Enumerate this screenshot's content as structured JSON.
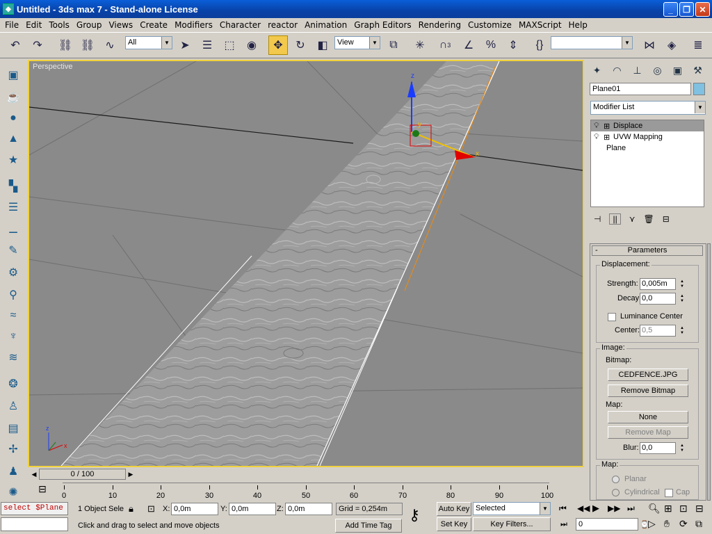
{
  "window": {
    "title": "Untitled - 3ds max 7  - Stand-alone License"
  },
  "menu": [
    "File",
    "Edit",
    "Tools",
    "Group",
    "Views",
    "Create",
    "Modifiers",
    "Character",
    "reactor",
    "Animation",
    "Graph Editors",
    "Rendering",
    "Customize",
    "MAXScript",
    "Help"
  ],
  "toolbar": {
    "selection_filter": "All",
    "reference_coord": "View",
    "named_selection": "",
    "snap_label": "3"
  },
  "viewport": {
    "label": "Perspective",
    "axis_x": "x",
    "axis_y": "y",
    "axis_z": "z"
  },
  "timeslider": {
    "frame_label": "0 / 100"
  },
  "trackbar": {
    "ticks": [
      "0",
      "10",
      "20",
      "30",
      "40",
      "50",
      "60",
      "70",
      "80",
      "90",
      "100"
    ]
  },
  "status": {
    "maxscript_input": "select $Plane",
    "selection_count": "1 Object Sele",
    "x_label": "X:",
    "x_value": "0,0m",
    "y_label": "Y:",
    "y_value": "0,0m",
    "z_label": "Z:",
    "z_value": "0,0m",
    "grid": "Grid = 0,254m",
    "prompt": "Click and drag to select and move objects",
    "add_time_tag": "Add Time Tag",
    "auto_key": "Auto Key",
    "set_key": "Set Key",
    "key_mode": "Selected",
    "key_filters": "Key Filters...",
    "current_frame": "0"
  },
  "command_panel": {
    "object_name": "Plane01",
    "object_color": "#80c0e0",
    "modifier_list": "Modifier List",
    "stack": [
      "Displace",
      "UVW Mapping",
      "Plane"
    ],
    "rollout_title": "Parameters",
    "displacement_title": "Displacement:",
    "strength_label": "Strength:",
    "strength_value": "0,005m",
    "decay_label": "Decay:",
    "decay_value": "0,0",
    "luminance_label": "Luminance Center",
    "center_label": "Center:",
    "center_value": "0,5",
    "image_title": "Image:",
    "bitmap_label": "Bitmap:",
    "bitmap_button": "CEDFENCE.JPG",
    "remove_bitmap": "Remove Bitmap",
    "map_label": "Map:",
    "map_button": "None",
    "remove_map": "Remove Map",
    "blur_label": "Blur:",
    "blur_value": "0,0",
    "map_group_title": "Map:",
    "planar": "Planar",
    "cylindrical": "Cylindrical",
    "cap": "Cap"
  }
}
